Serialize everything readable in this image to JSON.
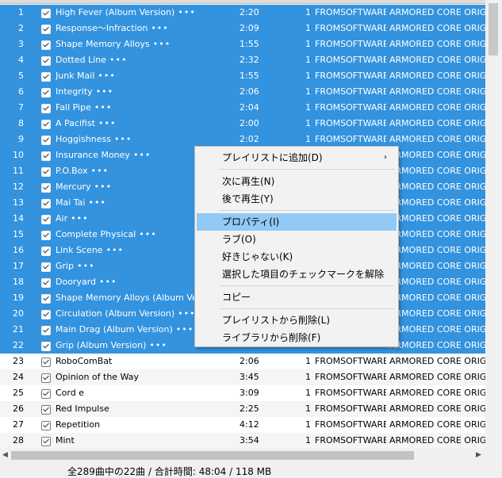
{
  "tracks": [
    {
      "num": "1",
      "title": "High Fever (Album Version)",
      "dur": "2:20",
      "track": "1",
      "artist": "FROMSOFTWARE",
      "album": "ARMORED CORE ORIGINAL",
      "selected": true
    },
    {
      "num": "2",
      "title": "Response～Infraction",
      "dur": "2:09",
      "track": "1",
      "artist": "FROMSOFTWARE",
      "album": "ARMORED CORE ORIGINAL",
      "selected": true
    },
    {
      "num": "3",
      "title": "Shape Memory Alloys",
      "dur": "1:55",
      "track": "1",
      "artist": "FROMSOFTWARE",
      "album": "ARMORED CORE ORIGINAL",
      "selected": true
    },
    {
      "num": "4",
      "title": "Dotted Line",
      "dur": "2:32",
      "track": "1",
      "artist": "FROMSOFTWARE",
      "album": "ARMORED CORE ORIGINAL",
      "selected": true
    },
    {
      "num": "5",
      "title": "Junk Mail",
      "dur": "1:55",
      "track": "1",
      "artist": "FROMSOFTWARE",
      "album": "ARMORED CORE ORIGINAL",
      "selected": true
    },
    {
      "num": "6",
      "title": "Integrity",
      "dur": "2:06",
      "track": "1",
      "artist": "FROMSOFTWARE",
      "album": "ARMORED CORE ORIGINAL",
      "selected": true
    },
    {
      "num": "7",
      "title": "Fall Pipe",
      "dur": "2:04",
      "track": "1",
      "artist": "FROMSOFTWARE",
      "album": "ARMORED CORE ORIGINAL",
      "selected": true
    },
    {
      "num": "8",
      "title": "A Pacifist",
      "dur": "2:00",
      "track": "1",
      "artist": "FROMSOFTWARE",
      "album": "ARMORED CORE ORIGINAL",
      "selected": true
    },
    {
      "num": "9",
      "title": "Hoggishness",
      "dur": "2:02",
      "track": "1",
      "artist": "FROMSOFTWARE",
      "album": "ARMORED CORE ORIGINAL",
      "selected": true
    },
    {
      "num": "10",
      "title": "Insurance Money",
      "dur": "",
      "track": "",
      "artist": "",
      "album": "ARMORED CORE ORIGINAL",
      "selected": true
    },
    {
      "num": "11",
      "title": "P.O.Box",
      "dur": "",
      "track": "",
      "artist": "",
      "album": "ARMORED CORE ORIGINAL",
      "selected": true
    },
    {
      "num": "12",
      "title": "Mercury",
      "dur": "",
      "track": "",
      "artist": "",
      "album": "ARMORED CORE ORIGINAL",
      "selected": true
    },
    {
      "num": "13",
      "title": "Mai Tai",
      "dur": "",
      "track": "",
      "artist": "",
      "album": "ARMORED CORE ORIGINAL",
      "selected": true
    },
    {
      "num": "14",
      "title": "Air",
      "dur": "",
      "track": "",
      "artist": "",
      "album": "ARMORED CORE ORIGINAL",
      "selected": true
    },
    {
      "num": "15",
      "title": "Complete Physical",
      "dur": "",
      "track": "",
      "artist": "",
      "album": "ARMORED CORE ORIGINAL",
      "selected": true
    },
    {
      "num": "16",
      "title": "Link Scene",
      "dur": "",
      "track": "",
      "artist": "",
      "album": "ARMORED CORE ORIGINAL",
      "selected": true
    },
    {
      "num": "17",
      "title": "Grip",
      "dur": "",
      "track": "",
      "artist": "",
      "album": "ARMORED CORE ORIGINAL",
      "selected": true
    },
    {
      "num": "18",
      "title": "Dooryard",
      "dur": "",
      "track": "",
      "artist": "",
      "album": "ARMORED CORE ORIGINAL",
      "selected": true
    },
    {
      "num": "19",
      "title": "Shape Memory Alloys (Album Ver...",
      "dur": "",
      "track": "",
      "artist": "",
      "album": "ARMORED CORE ORIGINAL",
      "selected": true
    },
    {
      "num": "20",
      "title": "Circulation (Album Version)",
      "dur": "",
      "track": "",
      "artist": "",
      "album": "ARMORED CORE ORIGINAL",
      "selected": true
    },
    {
      "num": "21",
      "title": "Main Drag (Album Version)",
      "dur": "",
      "track": "",
      "artist": "",
      "album": "ARMORED CORE ORIGINAL",
      "selected": true
    },
    {
      "num": "22",
      "title": "Grip (Album Version)",
      "dur": "",
      "track": "",
      "artist": "",
      "album": "ARMORED CORE ORIGINAL",
      "selected": true
    },
    {
      "num": "23",
      "title": "RoboComBat",
      "dur": "2:06",
      "track": "1",
      "artist": "FROMSOFTWARE",
      "album": "ARMORED CORE ORIGINAL",
      "selected": false
    },
    {
      "num": "24",
      "title": "Opinion of the Way",
      "dur": "3:45",
      "track": "1",
      "artist": "FROMSOFTWARE",
      "album": "ARMORED CORE ORIGINAL",
      "selected": false
    },
    {
      "num": "25",
      "title": "Cord e",
      "dur": "3:09",
      "track": "1",
      "artist": "FROMSOFTWARE",
      "album": "ARMORED CORE ORIGINAL",
      "selected": false
    },
    {
      "num": "26",
      "title": "Red Impulse",
      "dur": "2:25",
      "track": "1",
      "artist": "FROMSOFTWARE",
      "album": "ARMORED CORE ORIGINAL",
      "selected": false
    },
    {
      "num": "27",
      "title": "Repetition",
      "dur": "4:12",
      "track": "1",
      "artist": "FROMSOFTWARE",
      "album": "ARMORED CORE ORIGINAL",
      "selected": false
    },
    {
      "num": "28",
      "title": "Mint",
      "dur": "3:54",
      "track": "1",
      "artist": "FROMSOFTWARE",
      "album": "ARMORED CORE ORIGINAL",
      "selected": false
    }
  ],
  "more_symbol": "•••",
  "context_menu": {
    "add_to_playlist": "プレイリストに追加(D)",
    "play_next": "次に再生(N)",
    "play_later": "後で再生(Y)",
    "properties": "プロパティ(I)",
    "love": "ラブ(O)",
    "dislike": "好きじゃない(K)",
    "uncheck_selected": "選択した項目のチェックマークを解除",
    "copy": "コピー",
    "remove_from_playlist": "プレイリストから削除(L)",
    "remove_from_library": "ライブラリから削除(F)"
  },
  "status": "全289曲中の22曲 / 合計時間: 48:04 / 118 MB",
  "colors": {
    "selection": "#3393df",
    "menu_highlight": "#91c9f7"
  }
}
